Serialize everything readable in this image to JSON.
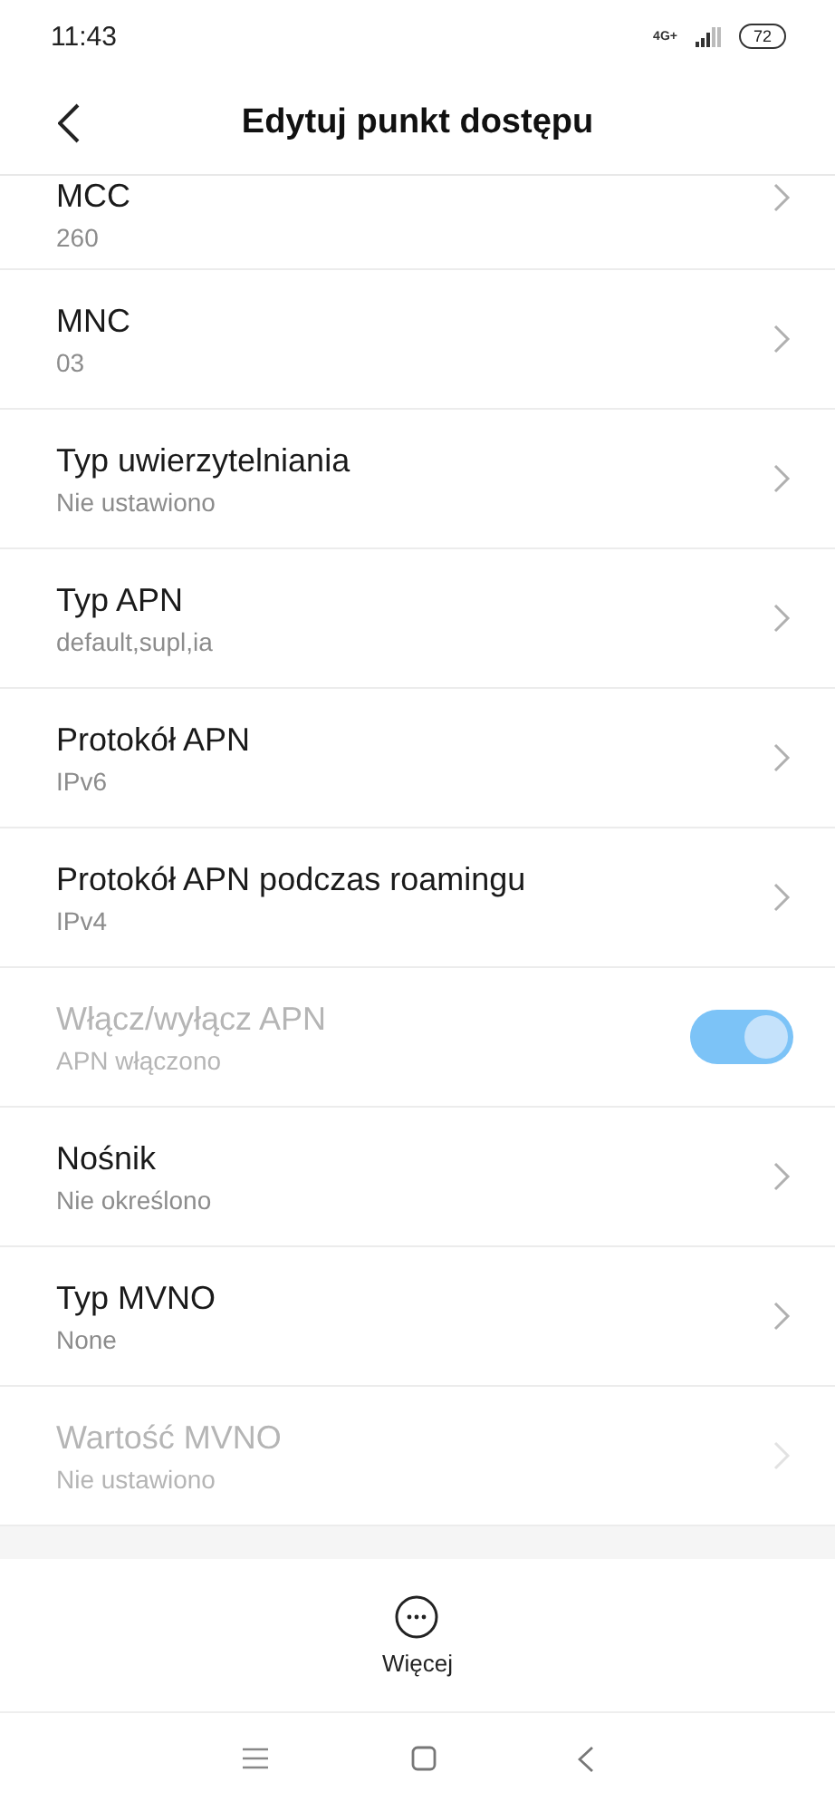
{
  "status_bar": {
    "time": "11:43",
    "network": "4G+",
    "battery": "72"
  },
  "header": {
    "title": "Edytuj punkt dostępu"
  },
  "rows": [
    {
      "kind": "chevron",
      "title": "MCC",
      "value": "260",
      "disabled": false
    },
    {
      "kind": "chevron",
      "title": "MNC",
      "value": "03",
      "disabled": false
    },
    {
      "kind": "chevron",
      "title": "Typ uwierzytelniania",
      "value": "Nie ustawiono",
      "disabled": false
    },
    {
      "kind": "chevron",
      "title": "Typ APN",
      "value": "default,supl,ia",
      "disabled": false
    },
    {
      "kind": "chevron",
      "title": "Protokół APN",
      "value": "IPv6",
      "disabled": false
    },
    {
      "kind": "chevron",
      "title": "Protokół APN podczas roamingu",
      "value": "IPv4",
      "disabled": false
    },
    {
      "kind": "toggle",
      "title": "Włącz/wyłącz APN",
      "value": "APN włączono",
      "disabled": true,
      "on": true
    },
    {
      "kind": "chevron",
      "title": "Nośnik",
      "value": "Nie określono",
      "disabled": false
    },
    {
      "kind": "chevron",
      "title": "Typ MVNO",
      "value": "None",
      "disabled": false
    },
    {
      "kind": "chevron",
      "title": "Wartość MVNO",
      "value": "Nie ustawiono",
      "disabled": true
    }
  ],
  "bottom_action": {
    "label": "Więcej"
  }
}
